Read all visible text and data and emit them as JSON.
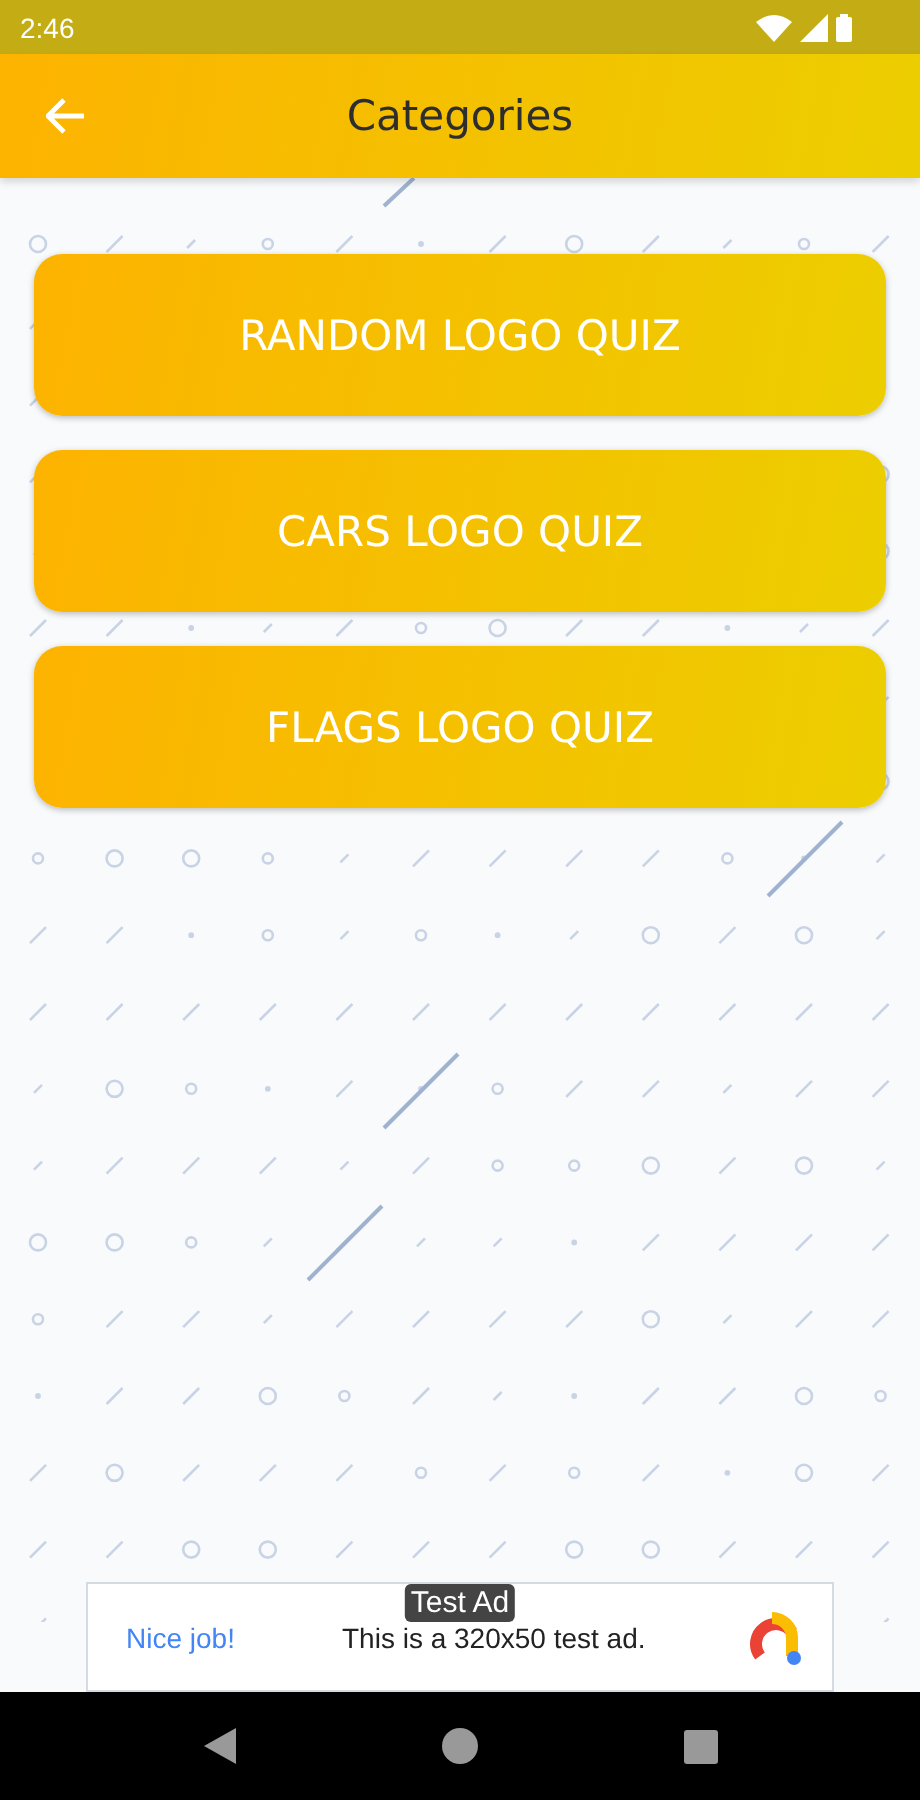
{
  "status_bar": {
    "time": "2:46"
  },
  "app_bar": {
    "title": "Categories"
  },
  "categories": [
    {
      "label": "RANDOM LOGO QUIZ"
    },
    {
      "label": "CARS LOGO QUIZ"
    },
    {
      "label": "FLAGS LOGO QUIZ"
    }
  ],
  "ad": {
    "badge": "Test Ad",
    "headline": "Nice job!",
    "body": "This is a 320x50 test ad."
  }
}
